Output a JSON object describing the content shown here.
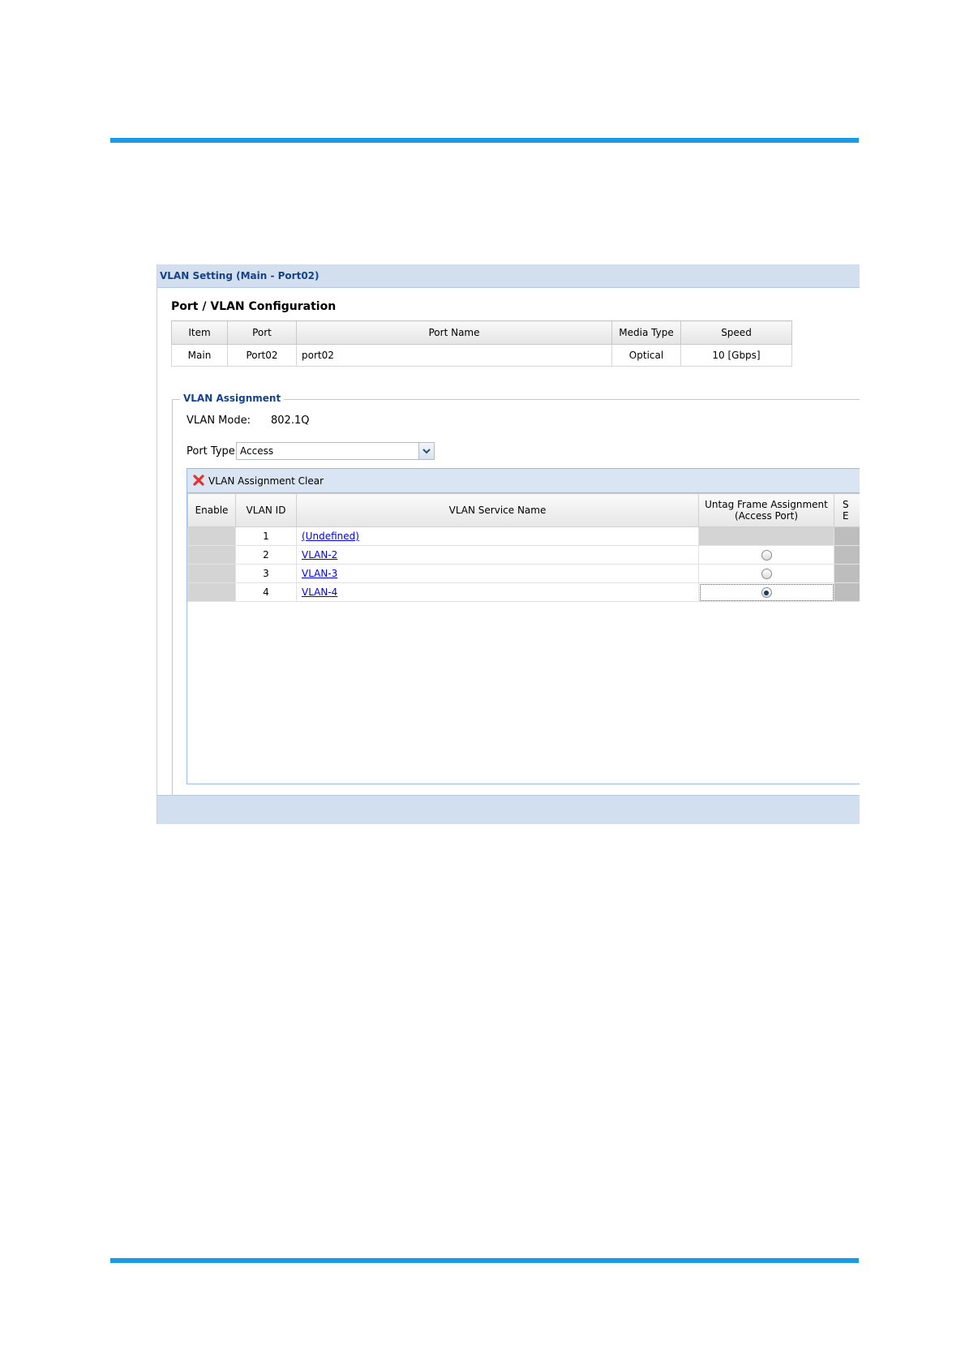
{
  "window": {
    "title": "VLAN Setting (Main - Port02)"
  },
  "config": {
    "heading": "Port / VLAN Configuration",
    "columns": [
      "Item",
      "Port",
      "Port Name",
      "Media Type",
      "Speed"
    ],
    "row": {
      "item": "Main",
      "port": "Port02",
      "port_name": "port02",
      "media_type": "Optical",
      "speed": "10 [Gbps]"
    }
  },
  "assignment": {
    "legend": "VLAN Assignment",
    "mode_label": "VLAN Mode:",
    "mode_value": "802.1Q",
    "port_type_label": "Port Type:",
    "port_type_value": "Access",
    "clear_label": "VLAN Assignment Clear",
    "columns": {
      "enable": "Enable",
      "vlan_id": "VLAN ID",
      "service_name": "VLAN Service Name",
      "untag_line1": "Untag Frame Assignment",
      "untag_line2": "(Access Port)",
      "next_line1": "S",
      "next_line2": "E"
    },
    "rows": [
      {
        "id": "1",
        "name": "(Undefined)",
        "untag": "none"
      },
      {
        "id": "2",
        "name": "VLAN-2",
        "untag": "unchecked"
      },
      {
        "id": "3",
        "name": "VLAN-3",
        "untag": "unchecked"
      },
      {
        "id": "4",
        "name": "VLAN-4",
        "untag": "checked"
      }
    ]
  },
  "colors": {
    "accent_rule": "#1a9be6",
    "title_text": "#15428b",
    "panel_bg": "#d2dfee"
  }
}
